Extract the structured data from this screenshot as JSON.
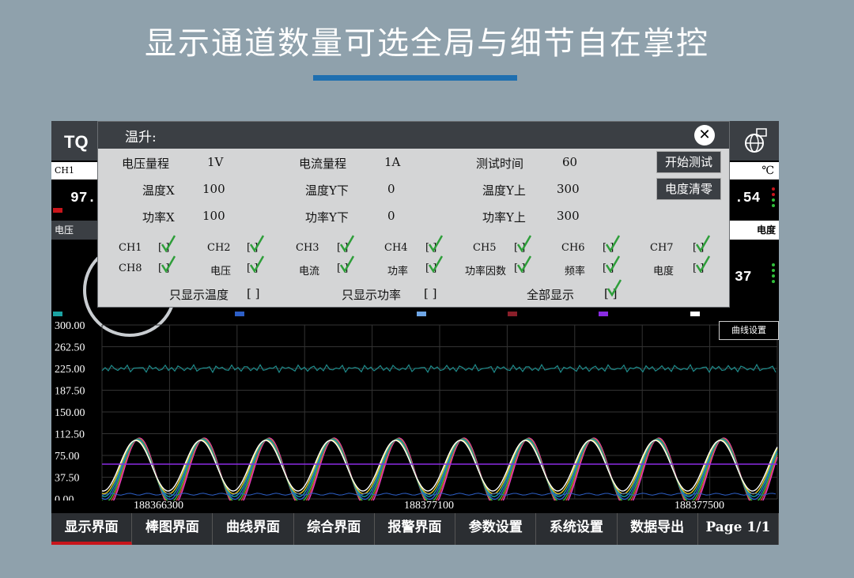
{
  "headline": "显示通道数量可选全局与细节自在掌控",
  "device": {
    "logo": "TQ",
    "ch1_label": "CH1",
    "unit_c": "℃",
    "left_value": "97.",
    "right_value": ".54",
    "left_label": "电压",
    "right_label": "电度",
    "right_value2": "37"
  },
  "dialog": {
    "title": "温升:",
    "close": "✕",
    "rows": [
      {
        "l1": "电压量程",
        "v1": "1V",
        "l2": "电流量程",
        "v2": "1A",
        "l3": "测试时间",
        "v3": "60"
      },
      {
        "l1": "温度X",
        "v1": "100",
        "l2": "温度Y下",
        "v2": "0",
        "l3": "温度Y上",
        "v3": "300"
      },
      {
        "l1": "功率X",
        "v1": "100",
        "l2": "功率Y下",
        "v2": "0",
        "l3": "功率Y上",
        "v3": "300"
      }
    ],
    "start_btn": "开始测试",
    "clear_btn": "电度清零",
    "checks_row1": [
      "CH1",
      "CH2",
      "CH3",
      "CH4",
      "CH5",
      "CH6",
      "CH7"
    ],
    "checks_row2": [
      "CH8",
      "电压",
      "电流",
      "功率",
      "功率因数",
      "频率",
      "电度"
    ],
    "only_temp": "只显示温度",
    "only_power": "只显示功率",
    "show_all": "全部显示",
    "empty_box": "[  ]",
    "checked_box": "[  ]"
  },
  "chart": {
    "curve_btn": "曲线设置",
    "y_ticks": [
      "300.00",
      "262.50",
      "225.00",
      "187.50",
      "150.00",
      "112.50",
      "75.00",
      "37.50",
      "0.00"
    ],
    "x_labels": [
      "188366300",
      "188377100",
      "188377500"
    ]
  },
  "nav": [
    "显示界面",
    "棒图界面",
    "曲线界面",
    "综合界面",
    "报警界面",
    "参数设置",
    "系统设置",
    "数据导出",
    "Page 1/1"
  ],
  "colors": {
    "accent_bar": "#1f6fb0",
    "nav_active": "#c8151b",
    "check": "#2e9e3a"
  }
}
